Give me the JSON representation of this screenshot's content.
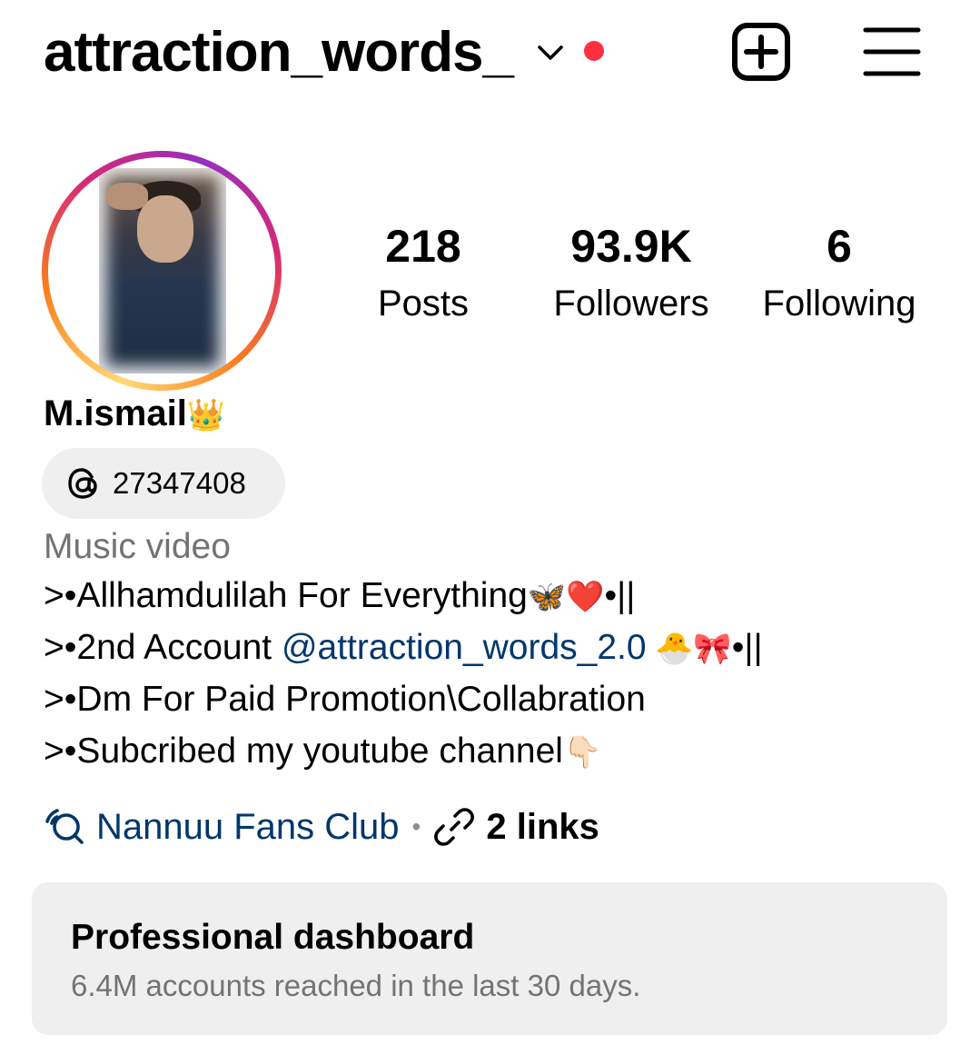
{
  "header": {
    "username": "attraction_words_",
    "icons": {
      "dropdown": "chevron-down-icon",
      "new_post": "plus-square-icon",
      "menu": "hamburger-menu-icon"
    },
    "notification_dot_color": "#ff3040"
  },
  "profile": {
    "avatar_icon": "profile-picture",
    "stats": [
      {
        "value": "218",
        "label": "Posts"
      },
      {
        "value": "93.9K",
        "label": "Followers"
      },
      {
        "value": "6",
        "label": "Following"
      }
    ],
    "display_name": "M.ismail",
    "display_name_emoji": "👑",
    "threads": {
      "icon": "threads-icon",
      "id": "27347408"
    },
    "category": "Music video",
    "bio": {
      "line1": {
        "text": ">•Allhamdulilah For Everything",
        "emoji": "🦋❤️",
        "suffix": "•||"
      },
      "line2": {
        "text": ">•2nd Account ",
        "mention": "@attraction_words_2.0",
        "emoji": " 🐣🎀",
        "suffix": "•||"
      },
      "line3": {
        "text": ">•Dm For Paid Promotion\\Collabration"
      },
      "line4": {
        "text": ">•Subcribed my youtube channel",
        "emoji": "👇🏻"
      }
    },
    "links_row": {
      "channel_icon": "broadcast-channel-icon",
      "channel_name": "Nannuu Fans Club",
      "separator": "•",
      "link_icon": "link-icon",
      "links_label": "2 links"
    }
  },
  "dashboard": {
    "title": "Professional dashboard",
    "subtitle": "6.4M accounts reached in the last 30 days."
  },
  "colors": {
    "link_blue": "#00376b",
    "secondary_text": "#737373",
    "pill_bg": "#efefef"
  }
}
